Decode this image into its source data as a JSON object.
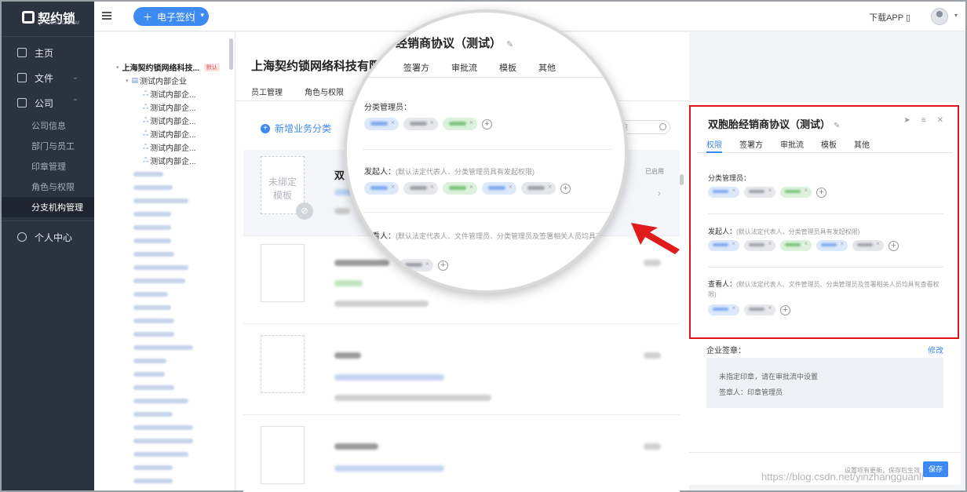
{
  "nav": {
    "logo_text": "契约锁",
    "logo_sub": "QIYUESUO.COM",
    "items": [
      {
        "label": "主页",
        "icon": "home-icon"
      },
      {
        "label": "文件",
        "icon": "file-icon"
      },
      {
        "label": "公司",
        "icon": "company-icon"
      }
    ],
    "company_sub": [
      "公司信息",
      "部门与员工",
      "印章管理",
      "角色与权限",
      "分支机构管理"
    ],
    "personal": "个人中心"
  },
  "topbar": {
    "sign_button": "电子签约",
    "download_app": "下载APP"
  },
  "tree": {
    "root": "上海契约锁网络科技...",
    "root_badge": "默认",
    "l1": "测试内部企业",
    "l2": [
      "测试内部企...",
      "测试内部企...",
      "测试内部企...",
      "测试内部企...",
      "测试内部企...",
      "测试内部企..."
    ]
  },
  "main": {
    "company": "上海契约锁网络科技有限公司",
    "tabs": [
      "员工管理",
      "角色与权限"
    ],
    "add_category": "新增业务分类",
    "cards": [
      {
        "thumb": "未绑定\n模板",
        "title": "双",
        "status": "已启用"
      },
      {
        "thumb": "",
        "title": "",
        "status": ""
      },
      {
        "thumb": "",
        "title": "",
        "status": ""
      },
      {
        "thumb": "",
        "title": "",
        "status": ""
      }
    ]
  },
  "magnifier": {
    "title": "经销商协议（测试）",
    "tabs": [
      "签署方",
      "审批流",
      "模板",
      "其他"
    ],
    "category_admin": "分类管理员：",
    "initiator": "发起人：",
    "initiator_hint": "(默认法定代表人、分类管理员具有发起权限)",
    "viewer": "查看人：",
    "viewer_hint": "(默认法定代表人、文件管理员、分类管理员及签署相关人员均具有查看权"
  },
  "panel": {
    "title": "双胞胎经销商协议（测试）",
    "tabs": [
      "权限",
      "签署方",
      "审批流",
      "模板",
      "其他"
    ],
    "category_admin": "分类管理员：",
    "initiator": "发起人：",
    "initiator_hint": "(默认法定代表人、分类管理员具有发起权限)",
    "viewer": "查看人：",
    "viewer_hint": "(默认法定代表人、文件管理员、分类管理员及签署相关人员均具有查看权限)",
    "seal_label": "企业签章：",
    "modify": "修改",
    "seal_line1": "未指定印章，请在审批流中设置",
    "seal_line2": "签章人：印章管理员",
    "save_hint": "设置项有更新，保存后生效",
    "save": "保存"
  },
  "watermark": "https://blog.csdn.net/yinzhangguanli",
  "colors": {
    "accent": "#3d8bf2",
    "highlight": "#e0121a",
    "nav_bg": "#2b3240"
  }
}
